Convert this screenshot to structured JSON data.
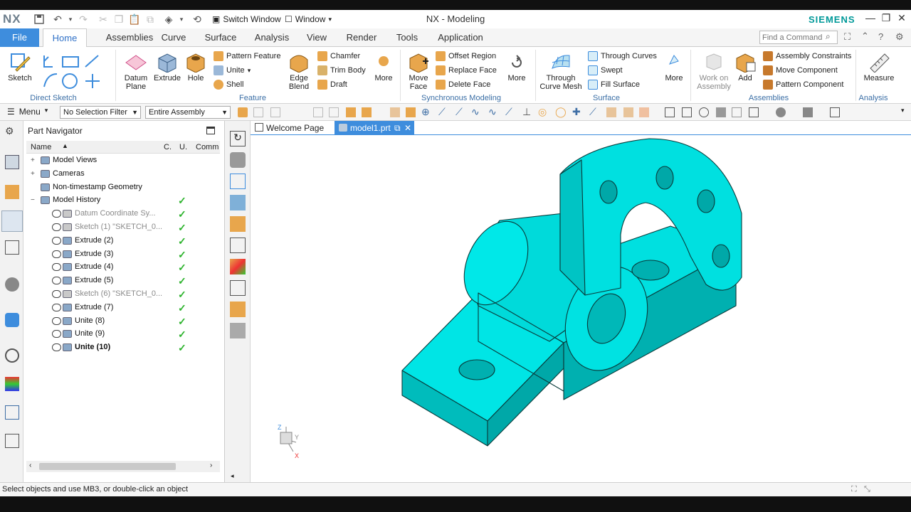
{
  "app": {
    "logo": "NX",
    "title": "NX - Modeling",
    "brand": "SIEMENS",
    "switch_window": "Switch Window",
    "window_menu": "Window",
    "find_command": "Find a Command"
  },
  "tabs": [
    "File",
    "Home",
    "Assemblies",
    "Curve",
    "Surface",
    "Analysis",
    "View",
    "Render",
    "Tools",
    "Application"
  ],
  "ribbon": {
    "sketch": "Sketch",
    "datum_plane": "Datum Plane",
    "extrude": "Extrude",
    "hole": "Hole",
    "pattern_feature": "Pattern Feature",
    "unite": "Unite",
    "shell": "Shell",
    "edge_blend": "Edge Blend",
    "chamfer": "Chamfer",
    "trim_body": "Trim Body",
    "draft": "Draft",
    "more1": "More",
    "move_face": "Move Face",
    "offset_region": "Offset Region",
    "replace_face": "Replace Face",
    "delete_face": "Delete Face",
    "more2": "More",
    "through_curve_mesh": "Through Curve Mesh",
    "through_curves": "Through Curves",
    "swept": "Swept",
    "fill_surface": "Fill Surface",
    "more3": "More",
    "work_on_assembly": "Work on Assembly",
    "add": "Add",
    "assembly_constraints": "Assembly Constraints",
    "move_component": "Move Component",
    "pattern_component": "Pattern Component",
    "measure": "Measure",
    "groups": {
      "direct_sketch": "Direct Sketch",
      "feature": "Feature",
      "synchronous_modeling": "Synchronous Modeling",
      "surface": "Surface",
      "assemblies": "Assemblies",
      "analysis": "Analysis"
    }
  },
  "toolbar": {
    "menu": "Menu",
    "selection_filter": "No Selection Filter",
    "scope": "Entire Assembly"
  },
  "navigator": {
    "title": "Part Navigator",
    "columns": [
      "Name",
      "C.",
      "U.",
      "Comm"
    ],
    "rows": [
      {
        "label": "Model Views",
        "indent": 0,
        "expand": "+",
        "style": "normal",
        "check": false
      },
      {
        "label": "Cameras",
        "indent": 0,
        "expand": "+",
        "style": "normal",
        "check": false
      },
      {
        "label": "Non-timestamp Geometry",
        "indent": 0,
        "expand": "",
        "style": "normal",
        "check": false
      },
      {
        "label": "Model History",
        "indent": 0,
        "expand": "−",
        "style": "normal",
        "check": true
      },
      {
        "label": "Datum Coordinate Sy...",
        "indent": 1,
        "expand": "",
        "style": "grey",
        "check": true
      },
      {
        "label": "Sketch (1) \"SKETCH_0...",
        "indent": 1,
        "expand": "",
        "style": "grey",
        "check": true
      },
      {
        "label": "Extrude (2)",
        "indent": 1,
        "expand": "",
        "style": "normal",
        "check": true
      },
      {
        "label": "Extrude (3)",
        "indent": 1,
        "expand": "",
        "style": "normal",
        "check": true
      },
      {
        "label": "Extrude (4)",
        "indent": 1,
        "expand": "",
        "style": "normal",
        "check": true
      },
      {
        "label": "Extrude (5)",
        "indent": 1,
        "expand": "",
        "style": "normal",
        "check": true
      },
      {
        "label": "Sketch (6) \"SKETCH_0...",
        "indent": 1,
        "expand": "",
        "style": "grey",
        "check": true
      },
      {
        "label": "Extrude (7)",
        "indent": 1,
        "expand": "",
        "style": "normal",
        "check": true
      },
      {
        "label": "Unite (8)",
        "indent": 1,
        "expand": "",
        "style": "normal",
        "check": true
      },
      {
        "label": "Unite (9)",
        "indent": 1,
        "expand": "",
        "style": "normal",
        "check": true
      },
      {
        "label": "Unite (10)",
        "indent": 1,
        "expand": "",
        "style": "bold",
        "check": true
      }
    ]
  },
  "doc_tabs": [
    "Welcome Page",
    "model1.prt"
  ],
  "status": "Select objects and use MB3, or double-click an object",
  "colors": {
    "model": "#00e5e5",
    "accent": "#3e8ddd",
    "check": "#2db32d",
    "brand": "#009999"
  }
}
